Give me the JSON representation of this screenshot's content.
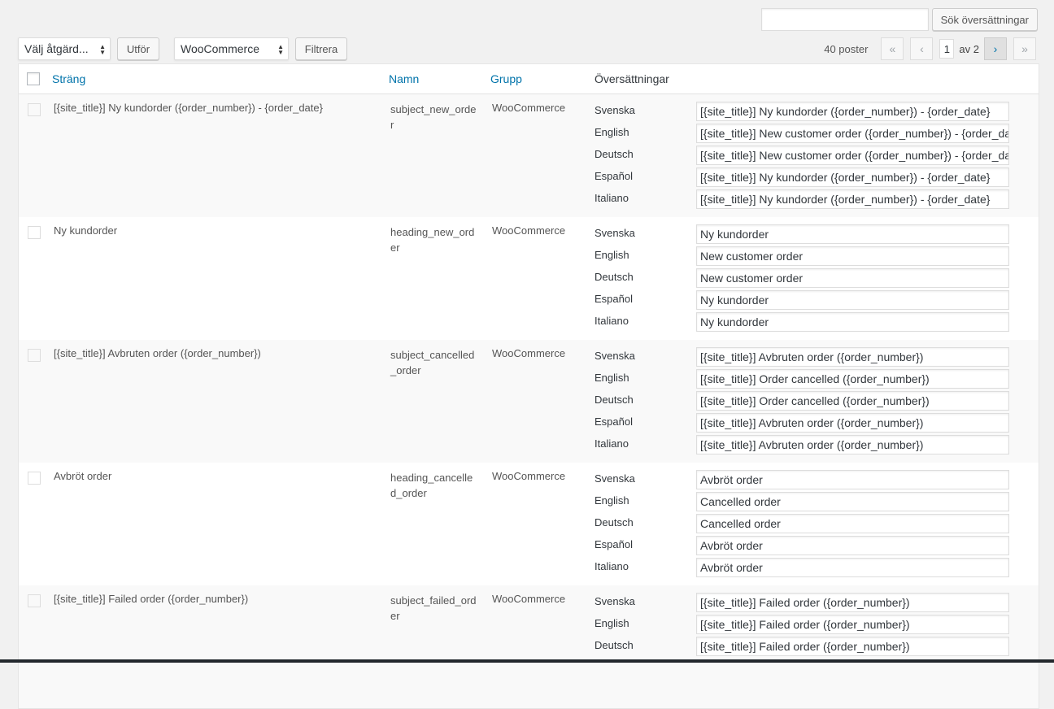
{
  "search": {
    "button_label": "Sök översättningar",
    "value": ""
  },
  "tablenav": {
    "bulk_action": "Välj åtgärd...",
    "apply_label": "Utför",
    "group_filter": "WooCommerce",
    "filter_label": "Filtrera",
    "items_count": "40 poster",
    "first": "«",
    "prev": "‹",
    "current_page": "1",
    "of_pages": "av 2",
    "next": "›",
    "last": "»"
  },
  "columns": {
    "string": "Sträng",
    "name": "Namn",
    "group": "Grupp",
    "translations": "Översättningar"
  },
  "rows": [
    {
      "string": "[{site_title}] Ny kundorder ({order_number}) - {order_date}",
      "name": "subject_new_order",
      "group": "WooCommerce",
      "translations": [
        {
          "lang": "Svenska",
          "value": "[{site_title}] Ny kundorder ({order_number}) - {order_date}"
        },
        {
          "lang": "English",
          "value": "[{site_title}] New customer order ({order_number}) - {order_date}"
        },
        {
          "lang": "Deutsch",
          "value": "[{site_title}] New customer order ({order_number}) - {order_date}"
        },
        {
          "lang": "Español",
          "value": "[{site_title}] Ny kundorder ({order_number}) - {order_date}"
        },
        {
          "lang": "Italiano",
          "value": "[{site_title}] Ny kundorder ({order_number}) - {order_date}"
        }
      ]
    },
    {
      "string": "Ny kundorder",
      "name": "heading_new_order",
      "group": "WooCommerce",
      "translations": [
        {
          "lang": "Svenska",
          "value": "Ny kundorder"
        },
        {
          "lang": "English",
          "value": "New customer order"
        },
        {
          "lang": "Deutsch",
          "value": "New customer order"
        },
        {
          "lang": "Español",
          "value": "Ny kundorder"
        },
        {
          "lang": "Italiano",
          "value": "Ny kundorder"
        }
      ]
    },
    {
      "string": "[{site_title}] Avbruten order ({order_number})",
      "name": "subject_cancelled_order",
      "group": "WooCommerce",
      "translations": [
        {
          "lang": "Svenska",
          "value": "[{site_title}] Avbruten order ({order_number})"
        },
        {
          "lang": "English",
          "value": "[{site_title}] Order cancelled ({order_number})"
        },
        {
          "lang": "Deutsch",
          "value": "[{site_title}] Order cancelled ({order_number})"
        },
        {
          "lang": "Español",
          "value": "[{site_title}] Avbruten order ({order_number})"
        },
        {
          "lang": "Italiano",
          "value": "[{site_title}] Avbruten order ({order_number})"
        }
      ]
    },
    {
      "string": "Avbröt order",
      "name": "heading_cancelled_order",
      "group": "WooCommerce",
      "translations": [
        {
          "lang": "Svenska",
          "value": "Avbröt order"
        },
        {
          "lang": "English",
          "value": "Cancelled order"
        },
        {
          "lang": "Deutsch",
          "value": "Cancelled order"
        },
        {
          "lang": "Español",
          "value": "Avbröt order"
        },
        {
          "lang": "Italiano",
          "value": "Avbröt order"
        }
      ]
    },
    {
      "string": "[{site_title}] Failed order ({order_number})",
      "name": "subject_failed_order",
      "group": "WooCommerce",
      "translations": [
        {
          "lang": "Svenska",
          "value": "[{site_title}] Failed order ({order_number})"
        },
        {
          "lang": "English",
          "value": "[{site_title}] Failed order ({order_number})"
        },
        {
          "lang": "Deutsch",
          "value": "[{site_title}] Failed order ({order_number})"
        }
      ]
    }
  ]
}
